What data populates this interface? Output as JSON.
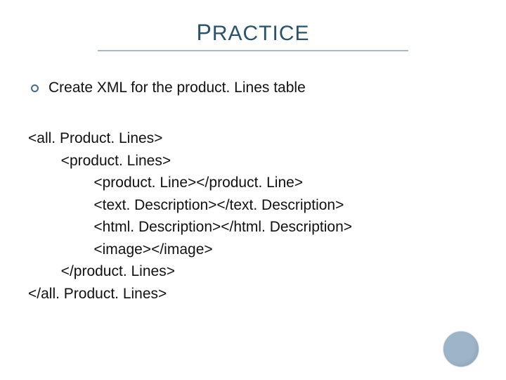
{
  "title_parts": {
    "cap1": "P",
    "rest1": "RACTICE"
  },
  "bullet": "Create XML for the product. Lines table",
  "code": {
    "l1": "<all. Product. Lines>",
    "l2": "        <product. Lines>",
    "l3": "                <product. Line></product. Line>",
    "l4": "                <text. Description></text. Description>",
    "l5": "                <html. Description></html. Description>",
    "l6": "                <image></image>",
    "l7": "        </product. Lines>",
    "l8": "</all. Product. Lines>"
  }
}
